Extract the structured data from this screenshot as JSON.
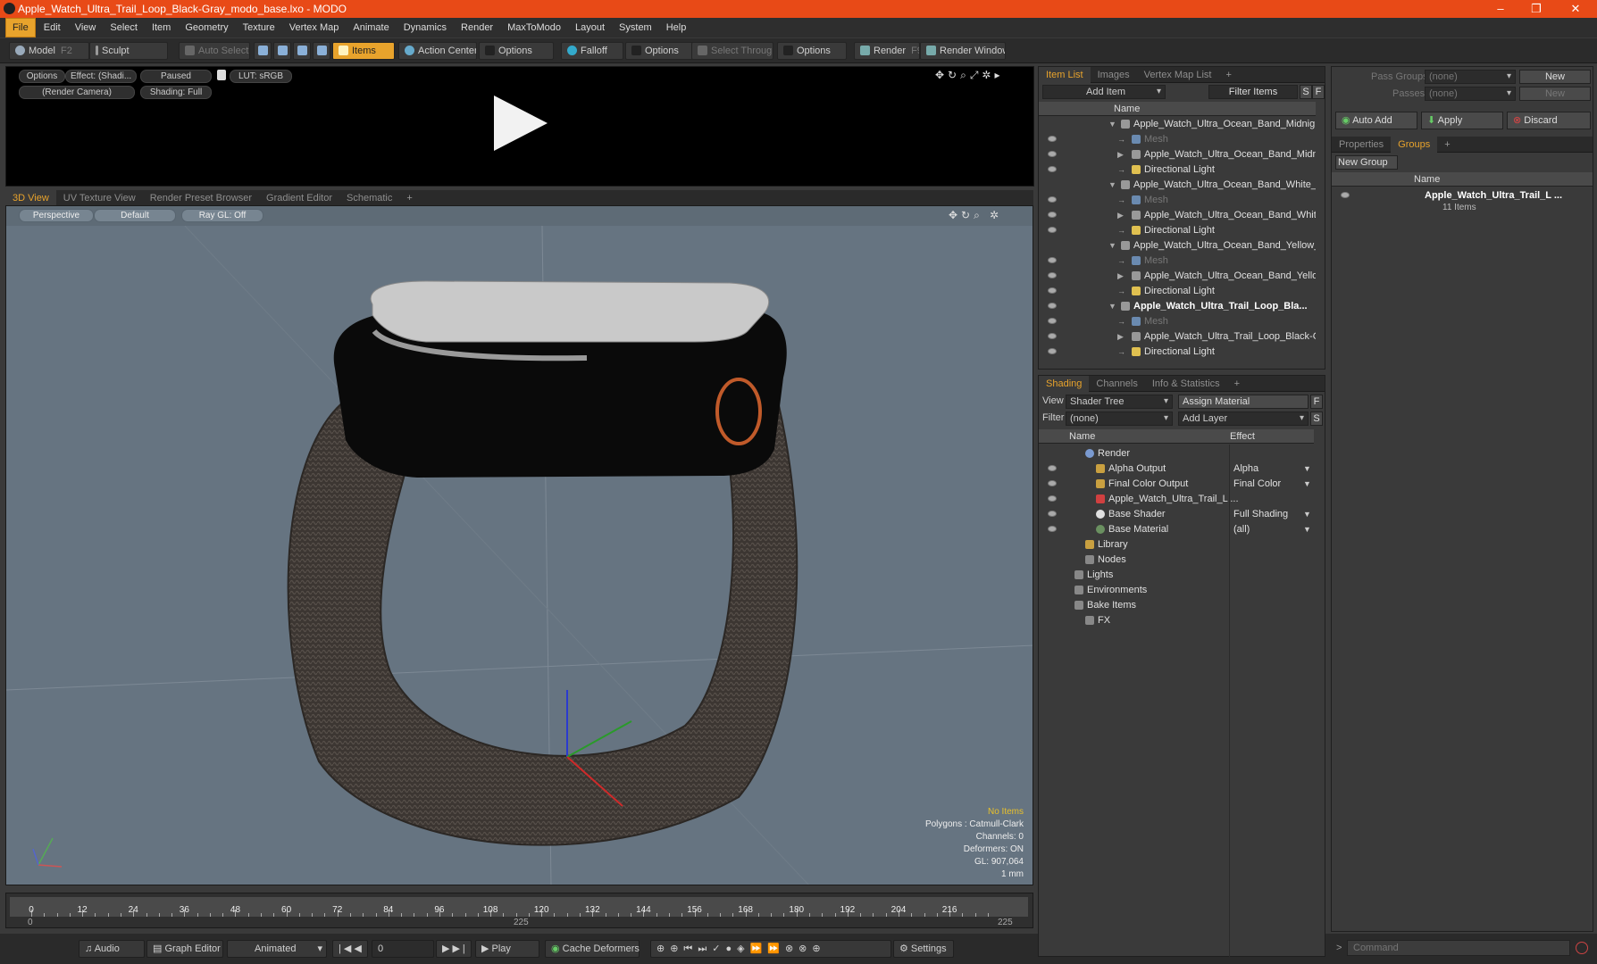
{
  "app": {
    "title": "Apple_Watch_Ultra_Trail_Loop_Black-Gray_modo_base.lxo - MODO",
    "window_controls": [
      "–",
      "❐",
      "✕"
    ]
  },
  "menu": [
    "File",
    "Edit",
    "View",
    "Select",
    "Item",
    "Geometry",
    "Texture",
    "Vertex Map",
    "Animate",
    "Dynamics",
    "Render",
    "MaxToModo",
    "Layout",
    "System",
    "Help"
  ],
  "toolbar": {
    "model": "Model",
    "model_key": "F2",
    "sculpt": "Sculpt",
    "auto_select": "Auto Select",
    "items": "Items",
    "action_center": "Action Center",
    "options1": "Options",
    "falloff": "Falloff",
    "options2": "Options",
    "select_through": "Select Through",
    "options3": "Options",
    "render": "Render",
    "render_key": "F9",
    "render_window": "Render Window"
  },
  "preview": {
    "options": "Options",
    "effect": "Effect: (Shadi...",
    "paused": "Paused",
    "lut": "LUT: sRGB",
    "camera": "(Render Camera)",
    "shading": "Shading: Full"
  },
  "view_tabs": [
    "3D View",
    "UV Texture View",
    "Render Preset Browser",
    "Gradient Editor",
    "Schematic",
    "+"
  ],
  "viewport": {
    "perspective": "Perspective",
    "default": "Default",
    "raygl": "Ray GL: Off",
    "stats": {
      "no_items": "No Items",
      "polygons": "Polygons : Catmull-Clark",
      "channels": "Channels: 0",
      "deformers": "Deformers: ON",
      "gl": "GL: 907,064",
      "unit": "1 mm"
    }
  },
  "timeline": {
    "ticks": [
      "0",
      "12",
      "24",
      "36",
      "48",
      "60",
      "72",
      "84",
      "96",
      "108",
      "120",
      "132",
      "144",
      "156",
      "168",
      "180",
      "192",
      "204",
      "216"
    ],
    "start": "0",
    "mid": "225",
    "end": "225"
  },
  "bottombar": {
    "audio": "Audio",
    "graph_editor": "Graph Editor",
    "animated": "Animated",
    "frame": "0",
    "play": "Play",
    "cache_deformers": "Cache Deformers",
    "settings": "Settings"
  },
  "item_list": {
    "tabs": [
      "Item List",
      "Images",
      "Vertex Map List",
      "+"
    ],
    "add_item": "Add Item",
    "filter_items": "Filter Items",
    "s": "S",
    "f": "F",
    "col_name": "Name",
    "rows": [
      {
        "label": "Apple_Watch_Ultra_Ocean_Band_Midnigh...",
        "type": "group"
      },
      {
        "label": "Mesh",
        "type": "mesh"
      },
      {
        "label": "Apple_Watch_Ultra_Ocean_Band_Midni...",
        "type": "child"
      },
      {
        "label": "Directional Light",
        "type": "light"
      },
      {
        "label": "Apple_Watch_Ultra_Ocean_Band_White_...",
        "type": "group"
      },
      {
        "label": "Mesh",
        "type": "mesh"
      },
      {
        "label": "Apple_Watch_Ultra_Ocean_Band_Whit...",
        "type": "child"
      },
      {
        "label": "Directional Light",
        "type": "light"
      },
      {
        "label": "Apple_Watch_Ultra_Ocean_Band_Yellow_...",
        "type": "group"
      },
      {
        "label": "Mesh",
        "type": "mesh"
      },
      {
        "label": "Apple_Watch_Ultra_Ocean_Band_Yello ...",
        "type": "child"
      },
      {
        "label": "Directional Light",
        "type": "light"
      },
      {
        "label": "Apple_Watch_Ultra_Trail_Loop_Bla...",
        "type": "group-bold"
      },
      {
        "label": "Mesh",
        "type": "mesh"
      },
      {
        "label": "Apple_Watch_Ultra_Trail_Loop_Black-G ...",
        "type": "child"
      },
      {
        "label": "Directional Light",
        "type": "light"
      }
    ]
  },
  "shading": {
    "tabs": [
      "Shading",
      "Channels",
      "Info & Statistics",
      "+"
    ],
    "view_label": "View",
    "view_value": "Shader Tree",
    "assign_material": "Assign Material",
    "f": "F",
    "filter_label": "Filter",
    "filter_value": "(none)",
    "add_layer": "Add Layer",
    "s": "S",
    "col_name": "Name",
    "col_effect": "Effect",
    "rows": [
      {
        "label": "Render",
        "effect": "",
        "indent": 1
      },
      {
        "label": "Alpha Output",
        "effect": "Alpha",
        "indent": 2
      },
      {
        "label": "Final Color Output",
        "effect": "Final Color",
        "indent": 2
      },
      {
        "label": "Apple_Watch_Ultra_Trail_L ...",
        "effect": "",
        "indent": 2
      },
      {
        "label": "Base Shader",
        "effect": "Full Shading",
        "indent": 2
      },
      {
        "label": "Base Material",
        "effect": "(all)",
        "indent": 2
      },
      {
        "label": "Library",
        "effect": "",
        "indent": 1
      },
      {
        "label": "Nodes",
        "effect": "",
        "indent": 1
      },
      {
        "label": "Lights",
        "effect": "",
        "indent": 0
      },
      {
        "label": "Environments",
        "effect": "",
        "indent": 0
      },
      {
        "label": "Bake Items",
        "effect": "",
        "indent": 0
      },
      {
        "label": "FX",
        "effect": "",
        "indent": 1
      }
    ]
  },
  "groups": {
    "pass_groups": "Pass Groups",
    "pass_groups_value": "(none)",
    "new": "New",
    "passes": "Passes",
    "passes_value": "(none)",
    "new2": "New",
    "auto_add": "Auto Add",
    "apply": "Apply",
    "discard": "Discard",
    "tabs": [
      "Properties",
      "Groups",
      "+"
    ],
    "new_group": "New Group",
    "col_name": "Name",
    "group_name": "Apple_Watch_Ultra_Trail_L ...",
    "group_count": "11 Items"
  },
  "command": {
    "placeholder": "Command"
  }
}
